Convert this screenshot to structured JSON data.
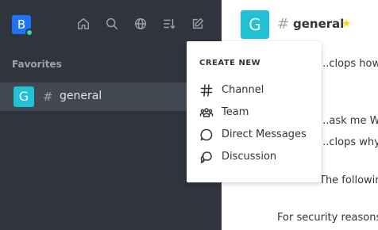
{
  "user": {
    "avatar_letter": "B"
  },
  "sidebar": {
    "favorites_label": "Favorites",
    "rooms": [
      {
        "avatar_letter": "G",
        "name": "general"
      }
    ]
  },
  "room": {
    "avatar_letter": "G",
    "name": "general"
  },
  "messages": [
    "...clops how w",
    "...ask me Why",
    "...clops why di",
    "The followin",
    "For security reasons,"
  ],
  "create_menu": {
    "title": "CREATE NEW",
    "items": [
      {
        "label": "Channel",
        "icon": "hash-icon"
      },
      {
        "label": "Team",
        "icon": "team-icon"
      },
      {
        "label": "Direct Messages",
        "icon": "direct-message-icon"
      },
      {
        "label": "Discussion",
        "icon": "discussion-icon"
      }
    ]
  },
  "colors": {
    "sidebar_bg": "#2f343d",
    "active_room_bg": "#414852",
    "brand": "#1d74f5",
    "room_avatar": "#1fc1d4",
    "status_online": "#2de0a5",
    "star": "#ffd21f"
  }
}
